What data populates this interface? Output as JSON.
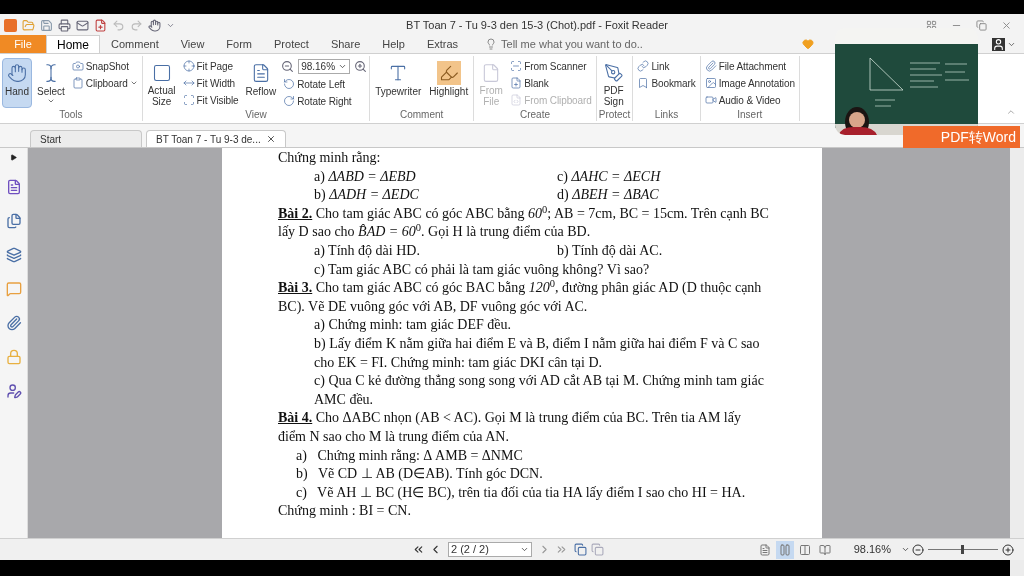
{
  "title_bar": {
    "title": "BT Toan 7 - Tu 9-3 den 15-3 (Chot).pdf - Foxit Reader"
  },
  "menu_tabs": [
    {
      "label": "File",
      "kind": "file",
      "selected": false
    },
    {
      "label": "Home",
      "kind": "tab",
      "selected": true
    },
    {
      "label": "Comment",
      "kind": "tab",
      "selected": false
    },
    {
      "label": "View",
      "kind": "tab",
      "selected": false
    },
    {
      "label": "Form",
      "kind": "tab",
      "selected": false
    },
    {
      "label": "Protect",
      "kind": "tab",
      "selected": false
    },
    {
      "label": "Share",
      "kind": "tab",
      "selected": false
    },
    {
      "label": "Help",
      "kind": "tab",
      "selected": false
    },
    {
      "label": "Extras",
      "kind": "tab",
      "selected": false
    }
  ],
  "tell_me": {
    "placeholder": "Tell me what you want to do.."
  },
  "ribbon": {
    "groups": [
      {
        "label": "Tools",
        "items": [
          {
            "kind": "large",
            "label": "Hand",
            "selected": true,
            "disabled": false,
            "caret": false
          },
          {
            "kind": "large",
            "label": "Select",
            "selected": false,
            "disabled": false,
            "caret": true
          },
          {
            "kind": "small",
            "label": "SnapShot",
            "selected": false,
            "disabled": false,
            "caret": false
          },
          {
            "kind": "small",
            "label": "Clipboard",
            "selected": false,
            "disabled": false,
            "caret": true
          }
        ]
      },
      {
        "label": "View",
        "items": [
          {
            "kind": "large",
            "label": "Actual Size",
            "selected": false,
            "disabled": false,
            "caret": false
          },
          {
            "kind": "small",
            "label": "Fit Page",
            "selected": false,
            "disabled": false,
            "caret": false
          },
          {
            "kind": "small",
            "label": "Fit Width",
            "selected": false,
            "disabled": false,
            "caret": false
          },
          {
            "kind": "small",
            "label": "Fit Visible",
            "selected": false,
            "disabled": false,
            "caret": false
          },
          {
            "kind": "large",
            "label": "Reflow",
            "selected": false,
            "disabled": false,
            "caret": false
          },
          {
            "kind": "combo",
            "label": "98.16%",
            "selected": false,
            "disabled": false,
            "caret": true
          },
          {
            "kind": "small",
            "label": "Rotate Left",
            "selected": false,
            "disabled": false,
            "caret": false
          },
          {
            "kind": "small",
            "label": "Rotate Right",
            "selected": false,
            "disabled": false,
            "caret": false
          }
        ]
      },
      {
        "label": "Comment",
        "items": [
          {
            "kind": "large",
            "label": "Typewriter",
            "selected": false,
            "disabled": false,
            "caret": false
          },
          {
            "kind": "large",
            "label": "Highlight",
            "selected": false,
            "disabled": false,
            "caret": false
          }
        ]
      },
      {
        "label": "Create",
        "items": [
          {
            "kind": "large",
            "label": "From File",
            "selected": false,
            "disabled": true,
            "caret": false
          },
          {
            "kind": "small",
            "label": "From Scanner",
            "selected": false,
            "disabled": false,
            "caret": false
          },
          {
            "kind": "small",
            "label": "Blank",
            "selected": false,
            "disabled": false,
            "caret": false
          },
          {
            "kind": "small",
            "label": "From Clipboard",
            "selected": false,
            "disabled": true,
            "caret": false
          }
        ]
      },
      {
        "label": "Protect",
        "items": [
          {
            "kind": "large",
            "label": "PDF Sign",
            "selected": false,
            "disabled": false,
            "caret": false
          }
        ]
      },
      {
        "label": "Links",
        "items": [
          {
            "kind": "small",
            "label": "Link",
            "selected": false,
            "disabled": false,
            "caret": false
          },
          {
            "kind": "small",
            "label": "Bookmark",
            "selected": false,
            "disabled": false,
            "caret": false
          }
        ]
      },
      {
        "label": "Insert",
        "items": [
          {
            "kind": "small",
            "label": "File Attachment",
            "selected": false,
            "disabled": false,
            "caret": false
          },
          {
            "kind": "small",
            "label": "Image Annotation",
            "selected": false,
            "disabled": false,
            "caret": false
          },
          {
            "kind": "small",
            "label": "Audio & Video",
            "selected": false,
            "disabled": false,
            "caret": false
          }
        ]
      }
    ]
  },
  "doc_tabs": [
    {
      "label": "Start",
      "selected": false,
      "closable": false
    },
    {
      "label": "BT Toan 7 - Tu 9-3 de...",
      "selected": true,
      "closable": true
    }
  ],
  "document": {
    "lines": [
      {
        "kind": "plain",
        "text": "Chứng minh rằng:"
      },
      {
        "kind": "pair",
        "left": "a) *ΔABD = ΔEBD*",
        "right": "c) *ΔAHC = ΔECH*"
      },
      {
        "kind": "pair",
        "left": "b) *ΔADH = ΔEDC*",
        "right": "d) *ΔBEH = ΔBAC*"
      },
      {
        "kind": "exercise",
        "label": "Bài 2.",
        "text": "Cho tam giác ABC có góc ABC bằng *60*$^{0}$; AB = 7cm, BC = 15cm. Trên cạnh BC"
      },
      {
        "kind": "plain",
        "text": "lấy D sao cho *B̂AD = 60*$^{0}$. Gọi H là trung điểm của BD."
      },
      {
        "kind": "pair",
        "left": "a) Tính độ dài HD.",
        "right": "b) Tính độ dài AC."
      },
      {
        "kind": "item",
        "text": "c) Tam giác ABC có phải là tam giác vuông không? Vì sao?"
      },
      {
        "kind": "exercise",
        "label": "Bài 3.",
        "text": "Cho tam giác ABC có góc BAC bằng *120*$^{0}$, đường phân giác AD (D thuộc cạnh"
      },
      {
        "kind": "plain",
        "text": "BC). Vẽ DE vuông góc với AB, DF vuông góc với AC."
      },
      {
        "kind": "item",
        "text": "a) Chứng minh:  tam giác DEF đều."
      },
      {
        "kind": "item",
        "text": "b) Lấy điểm K nằm giữa hai điểm E và B, điểm I nằm giữa hai điểm F và C sao"
      },
      {
        "kind": "item",
        "text": "cho EK = FI. Chứng minh: tam giác DKI cân tại D."
      },
      {
        "kind": "item",
        "text": "c) Qua C kẻ đường thẳng song song với AD cắt AB tại M. Chứng minh tam giác"
      },
      {
        "kind": "item",
        "text": "AMC đều."
      },
      {
        "kind": "exercise",
        "label": "Bài 4.",
        "text": "Cho ΔABC nhọn (AB < AC). Gọi M là trung điểm của BC. Trên tia AM lấy"
      },
      {
        "kind": "plain",
        "text": "điểm N sao cho M là trung điểm của AN."
      },
      {
        "kind": "step",
        "text": "a)   Chứng minh rằng: Δ AMB = ΔNMC"
      },
      {
        "kind": "step",
        "text": "b)   Vẽ CD ⊥ AB (D∈AB). Tính góc DCN."
      },
      {
        "kind": "step",
        "text": "c)   Vẽ AH ⊥ BC (H∈ BC), trên tia đối của tia HA lấy điểm I sao cho HI = HA."
      },
      {
        "kind": "plain",
        "text": "Chứng minh : BI = CN."
      }
    ]
  },
  "status_bar": {
    "page": "2 (2 / 2)",
    "view_modes": [
      {
        "selected": false
      },
      {
        "selected": true
      },
      {
        "selected": false
      },
      {
        "selected": false
      }
    ],
    "zoom": "98.16%",
    "zoom_slider": {
      "level": 0.48
    }
  },
  "overlay": {
    "banner": "PDF转Word"
  }
}
